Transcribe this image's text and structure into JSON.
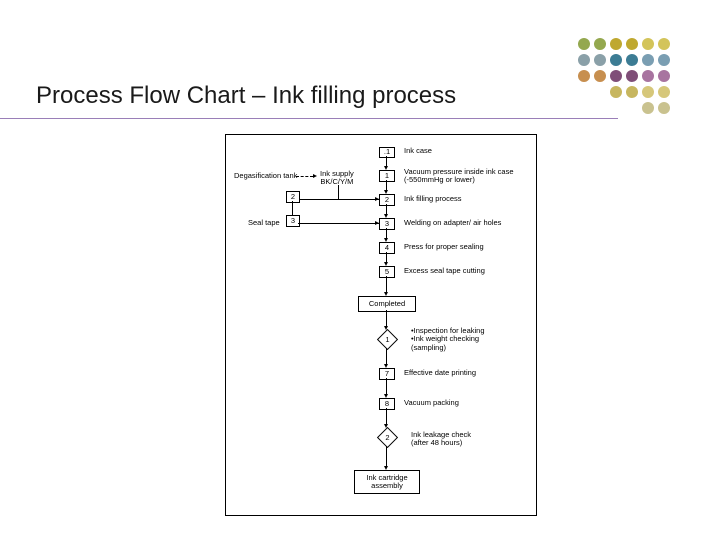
{
  "title": "Process Flow Chart – Ink filling process",
  "side": {
    "degas": "Degasification tank",
    "ink_supply": "Ink supply\nBK/C/Y/M",
    "seal_tape": "Seal tape"
  },
  "flow": {
    "dot1": ".1",
    "lbl1": "Ink case",
    "step1": "1",
    "lbl_step1": "Vacuum pressure inside ink case\n(-550mmHg or lower)",
    "step2": "2",
    "lbl_step2": "Ink filling process",
    "step3": "3",
    "lbl_step3": "Welding on adapter/ air holes",
    "step4": "4",
    "lbl_step4": "Press for proper sealing",
    "step5": "5",
    "lbl_step5": "Excess seal tape cutting",
    "completed": "Completed",
    "insp1": "1",
    "lbl_insp1": "•Inspection for leaking\n•Ink weight checking\n(sampling)",
    "step7": "7",
    "lbl_step7": "Effective date printing",
    "step8": "8",
    "lbl_step8": "Vacuum packing",
    "insp2": "2",
    "lbl_insp2": "Ink leakage check\n(after 48 hours)",
    "assembly": "Ink cartridge\nassembly"
  },
  "aux": {
    "num2": "2",
    "num3": "3"
  }
}
